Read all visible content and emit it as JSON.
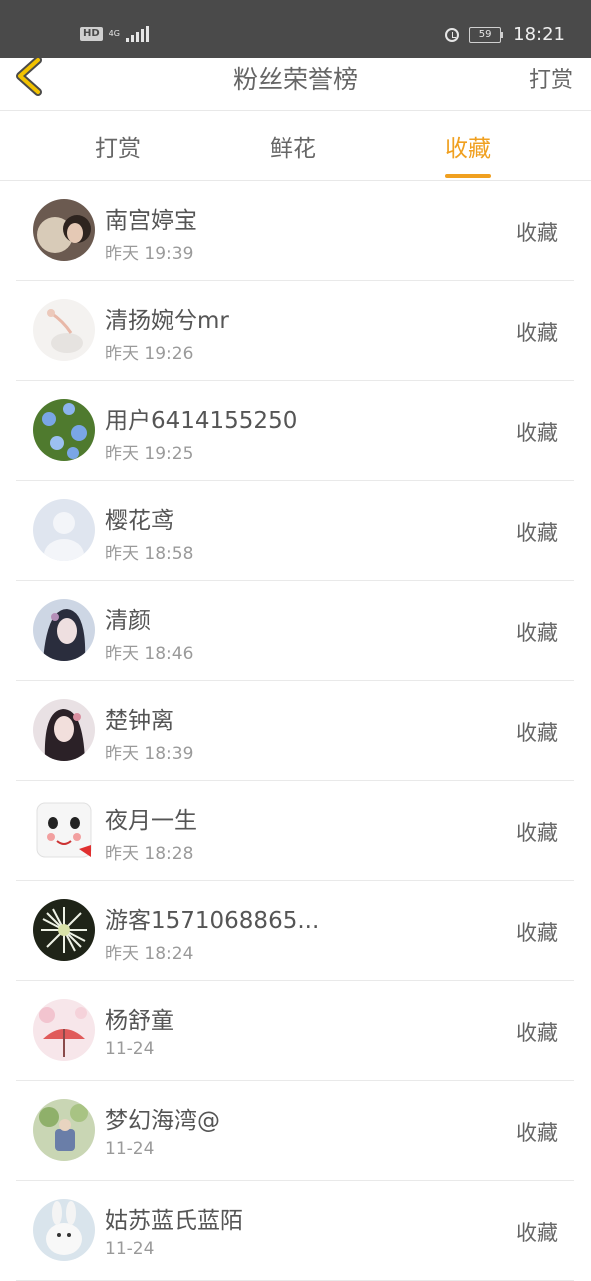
{
  "status_bar": {
    "hd": "HD",
    "network": "4G",
    "battery": "59",
    "time": "18:21"
  },
  "header": {
    "title": "粉丝荣誉榜",
    "action": "打赏"
  },
  "tabs": [
    {
      "label": "打赏",
      "active": false
    },
    {
      "label": "鲜花",
      "active": false
    },
    {
      "label": "收藏",
      "active": true
    }
  ],
  "fans": [
    {
      "name": "南宫婷宝",
      "time": "昨天 19:39",
      "action": "收藏"
    },
    {
      "name": "清扬婉兮mr",
      "time": "昨天 19:26",
      "action": "收藏"
    },
    {
      "name": "用户6414155250",
      "time": "昨天 19:25",
      "action": "收藏"
    },
    {
      "name": "樱花鸢",
      "time": "昨天 18:58",
      "action": "收藏"
    },
    {
      "name": "清颜",
      "time": "昨天 18:46",
      "action": "收藏"
    },
    {
      "name": "楚钟离",
      "time": "昨天 18:39",
      "action": "收藏"
    },
    {
      "name": "夜月一生",
      "time": "昨天 18:28",
      "action": "收藏"
    },
    {
      "name": "游客1571068865...",
      "time": "昨天 18:24",
      "action": "收藏"
    },
    {
      "name": "杨舒童",
      "time": "11-24",
      "action": "收藏"
    },
    {
      "name": "梦幻海湾@",
      "time": "11-24",
      "action": "收藏"
    },
    {
      "name": "姑苏蓝氏蓝陌",
      "time": "11-24",
      "action": "收藏"
    }
  ],
  "colors": {
    "accent": "#f0a020",
    "status_bar_bg": "#4a4a4a",
    "back_arrow": "#f2c200"
  }
}
